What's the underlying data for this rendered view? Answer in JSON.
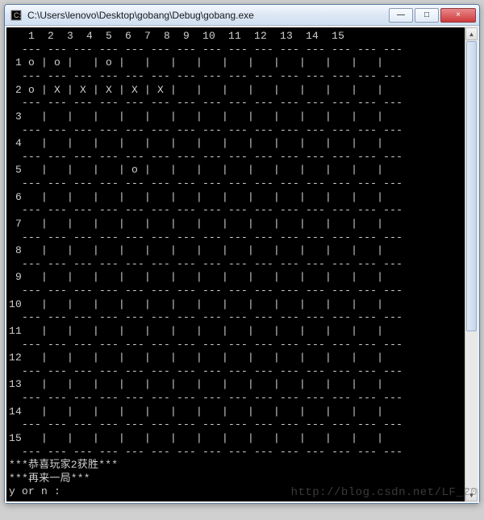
{
  "window": {
    "title": "C:\\Users\\lenovo\\Desktop\\gobang\\Debug\\gobang.exe",
    "minimize_label": "—",
    "maximize_label": "□",
    "close_label": "×"
  },
  "board": {
    "size": 15,
    "col_header": "   1  2  3  4  5  6  7  8  9  10  11  12  13  14  15",
    "pieces": {
      "1": {
        "1": "o",
        "2": "o",
        "4": "o"
      },
      "2": {
        "1": "o",
        "2": "X",
        "3": "X",
        "4": "X",
        "5": "X",
        "6": "X"
      },
      "5": {
        "5": "o"
      }
    }
  },
  "messages": {
    "win": "***恭喜玩家2获胜***",
    "replay": "***再来一局***",
    "prompt": "y or n :"
  },
  "watermark": "http://blog.csdn.net/LF_20"
}
